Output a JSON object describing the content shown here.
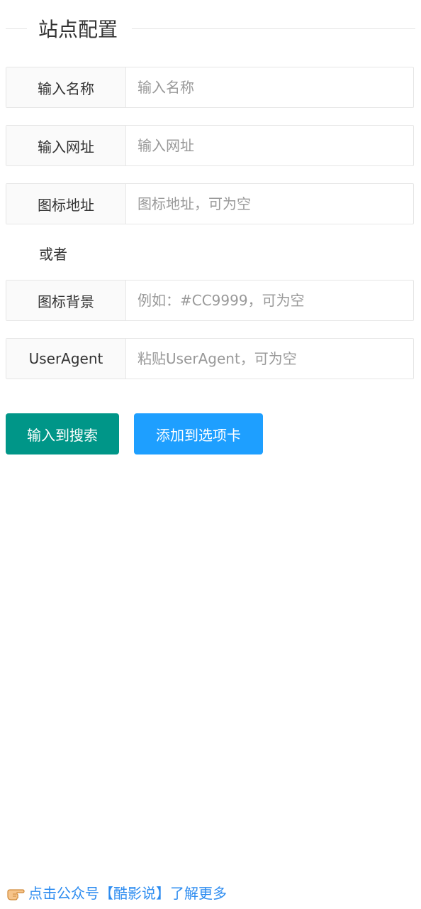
{
  "section": {
    "title": "站点配置"
  },
  "fields": {
    "name": {
      "label": "输入名称",
      "placeholder": "输入名称",
      "value": ""
    },
    "url": {
      "label": "输入网址",
      "placeholder": "输入网址",
      "value": ""
    },
    "icon_url": {
      "label": "图标地址",
      "placeholder": "图标地址，可为空",
      "value": ""
    },
    "or_text": "或者",
    "icon_bg": {
      "label": "图标背景",
      "placeholder": "例如：#CC9999，可为空",
      "value": ""
    },
    "user_agent": {
      "label": "UserAgent",
      "placeholder": "粘贴UserAgent，可为空",
      "value": ""
    }
  },
  "buttons": {
    "to_search": "输入到搜索",
    "add_tab": "添加到选项卡"
  },
  "footer": {
    "icon": "pointing-hand-icon",
    "link_text": "点击公众号【酷影说】了解更多"
  },
  "colors": {
    "primary_button": "#009688",
    "secondary_button": "#1e9fff",
    "link": "#2d8cf0"
  }
}
